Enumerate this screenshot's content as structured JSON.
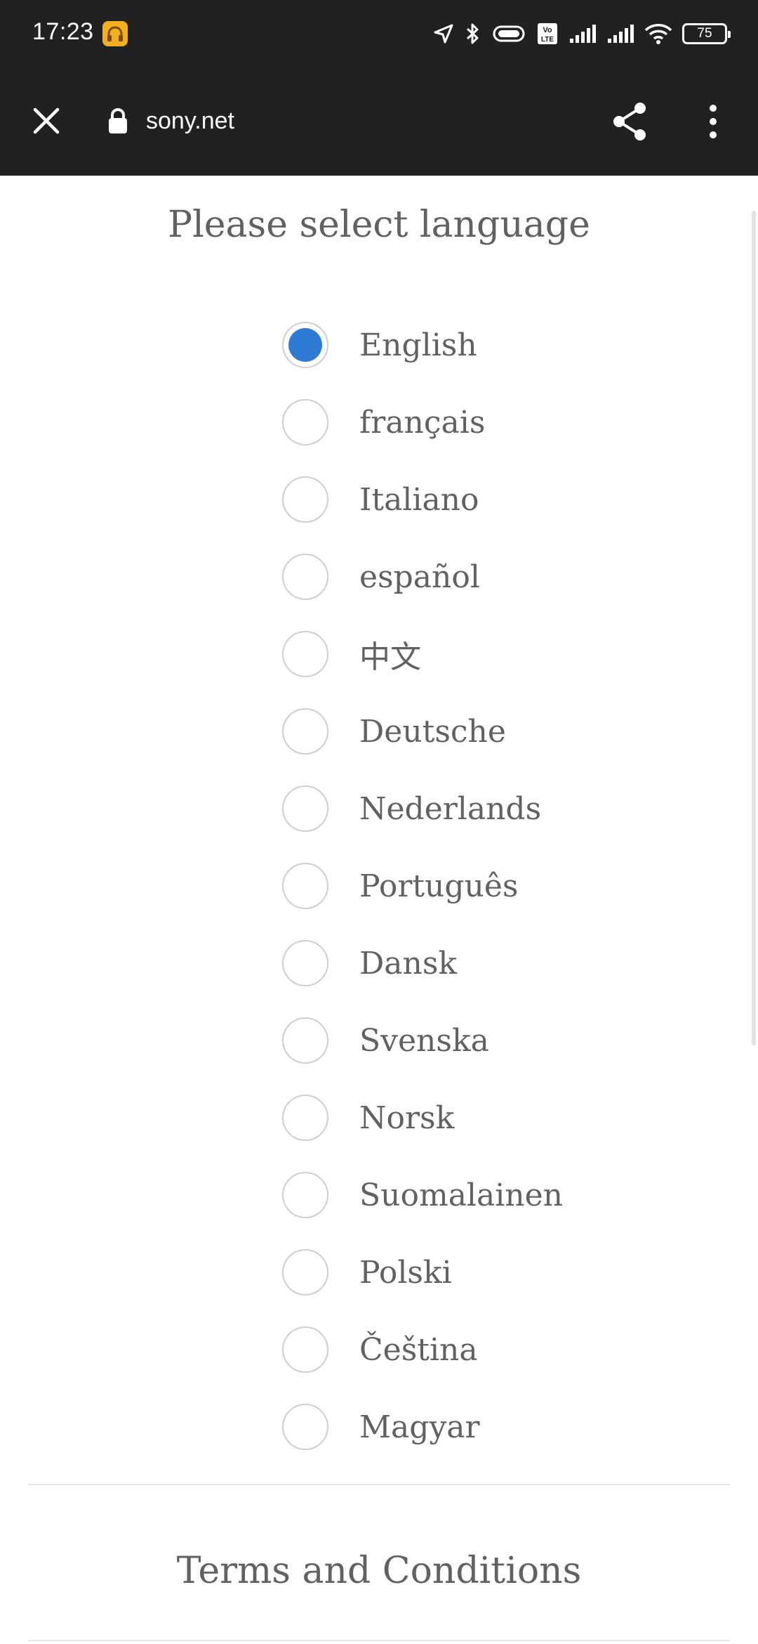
{
  "status_bar": {
    "time": "17:23",
    "battery": "75",
    "icons": [
      "headphones-app-icon",
      "location-icon",
      "bluetooth-icon",
      "vibrate-icon",
      "volte-icon",
      "signal-icon",
      "signal-icon",
      "wifi-icon",
      "battery-icon"
    ]
  },
  "browser": {
    "url": "sony.net",
    "icons": {
      "close": "close-icon",
      "lock": "lock-icon",
      "share": "share-icon",
      "menu": "more-vert-icon"
    }
  },
  "page": {
    "title": "Please select language",
    "selected_language": "English",
    "languages": [
      {
        "label": "English",
        "selected": true
      },
      {
        "label": "français",
        "selected": false
      },
      {
        "label": "Italiano",
        "selected": false
      },
      {
        "label": "español",
        "selected": false
      },
      {
        "label": "中文",
        "selected": false
      },
      {
        "label": "Deutsche",
        "selected": false
      },
      {
        "label": "Nederlands",
        "selected": false
      },
      {
        "label": "Português",
        "selected": false
      },
      {
        "label": "Dansk",
        "selected": false
      },
      {
        "label": "Svenska",
        "selected": false
      },
      {
        "label": "Norsk",
        "selected": false
      },
      {
        "label": "Suomalainen",
        "selected": false
      },
      {
        "label": "Polski",
        "selected": false
      },
      {
        "label": "Čeština",
        "selected": false
      },
      {
        "label": "Magyar",
        "selected": false
      }
    ],
    "section_title": "Terms and Conditions"
  },
  "colors": {
    "toolbar_bg": "#212121",
    "radio_selected": "#2d7bd4",
    "text": "#616161"
  }
}
